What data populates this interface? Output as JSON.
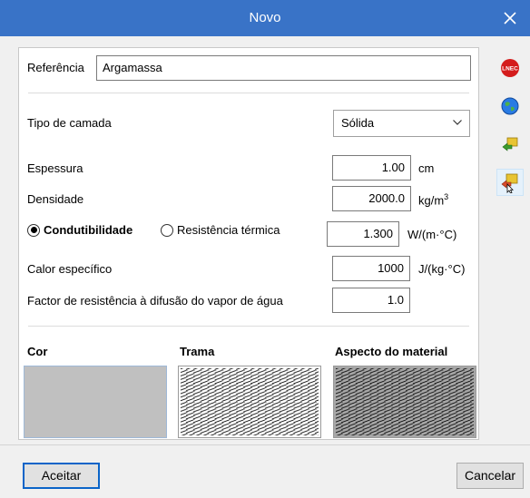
{
  "window": {
    "title": "Novo",
    "close_icon": "close-icon"
  },
  "form": {
    "referencia": {
      "label": "Referência",
      "value": "Argamassa"
    },
    "tipo_camada": {
      "label": "Tipo de camada",
      "selected": "Sólida"
    },
    "espessura": {
      "label": "Espessura",
      "value": "1.00",
      "unit": "cm"
    },
    "densidade": {
      "label": "Densidade",
      "value": "2000.0",
      "unit": "kg/m",
      "unit_sup": "3"
    },
    "condutibilidade": {
      "label": "Condutibilidade",
      "selected": true
    },
    "resistencia": {
      "label": "Resistência térmica",
      "selected": false
    },
    "condutibilidade_value": {
      "value": "1.300",
      "unit": "W/(m·°C)"
    },
    "calor": {
      "label": "Calor específico",
      "value": "1000",
      "unit": "J/(kg·°C)"
    },
    "factor": {
      "label": "Factor de resistência à difusão do vapor de água",
      "value": "1.0"
    }
  },
  "appearance": {
    "cor_label": "Cor",
    "trama_label": "Trama",
    "aspecto_label": "Aspecto do material",
    "cor_color": "#c0c0c0"
  },
  "sidebar": {
    "lnec_text": "LNEC",
    "icons": [
      "lnec-icon",
      "globe-icon",
      "import-icon",
      "export-icon"
    ]
  },
  "footer": {
    "accept_label": "Aceitar",
    "cancel_label": "Cancelar"
  },
  "colors": {
    "titlebar": "#3973c7",
    "focus": "#0a64c8"
  }
}
